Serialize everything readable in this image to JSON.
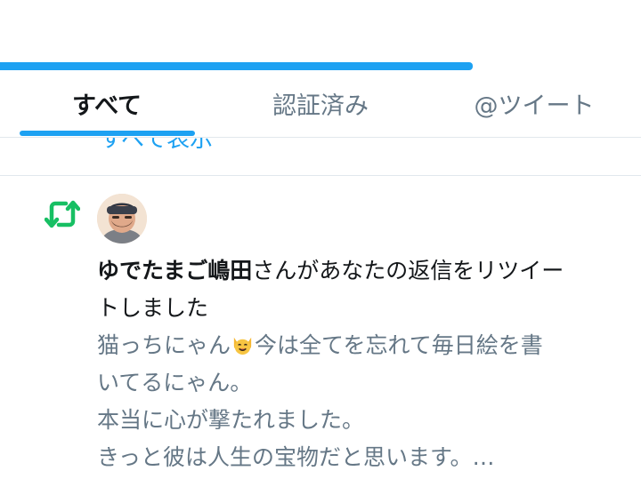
{
  "tabs": [
    {
      "label": "すべて",
      "active": true
    },
    {
      "label": "認証済み"
    },
    {
      "label": "@ツイート"
    }
  ],
  "previous_item": {
    "show_all": "すべて表示"
  },
  "notification": {
    "icon": "retweet-icon",
    "user_name": "ゆでたまご嶋田",
    "action_line1": "さんがあなたの返信をリツイー",
    "action_line2": "トしました",
    "tweet_lines": [
      "猫っちにゃん",
      "今は全てを忘れて毎日絵を書",
      "いてるにゃん。",
      "本当に心が撃たれました。",
      "きっと彼は人生の宝物だと思います。…"
    ],
    "emoji": "cat-face-emoji"
  },
  "colors": {
    "accent": "#1da1f2",
    "retweet": "#17bf63",
    "muted": "#657786",
    "text": "#14171a"
  }
}
